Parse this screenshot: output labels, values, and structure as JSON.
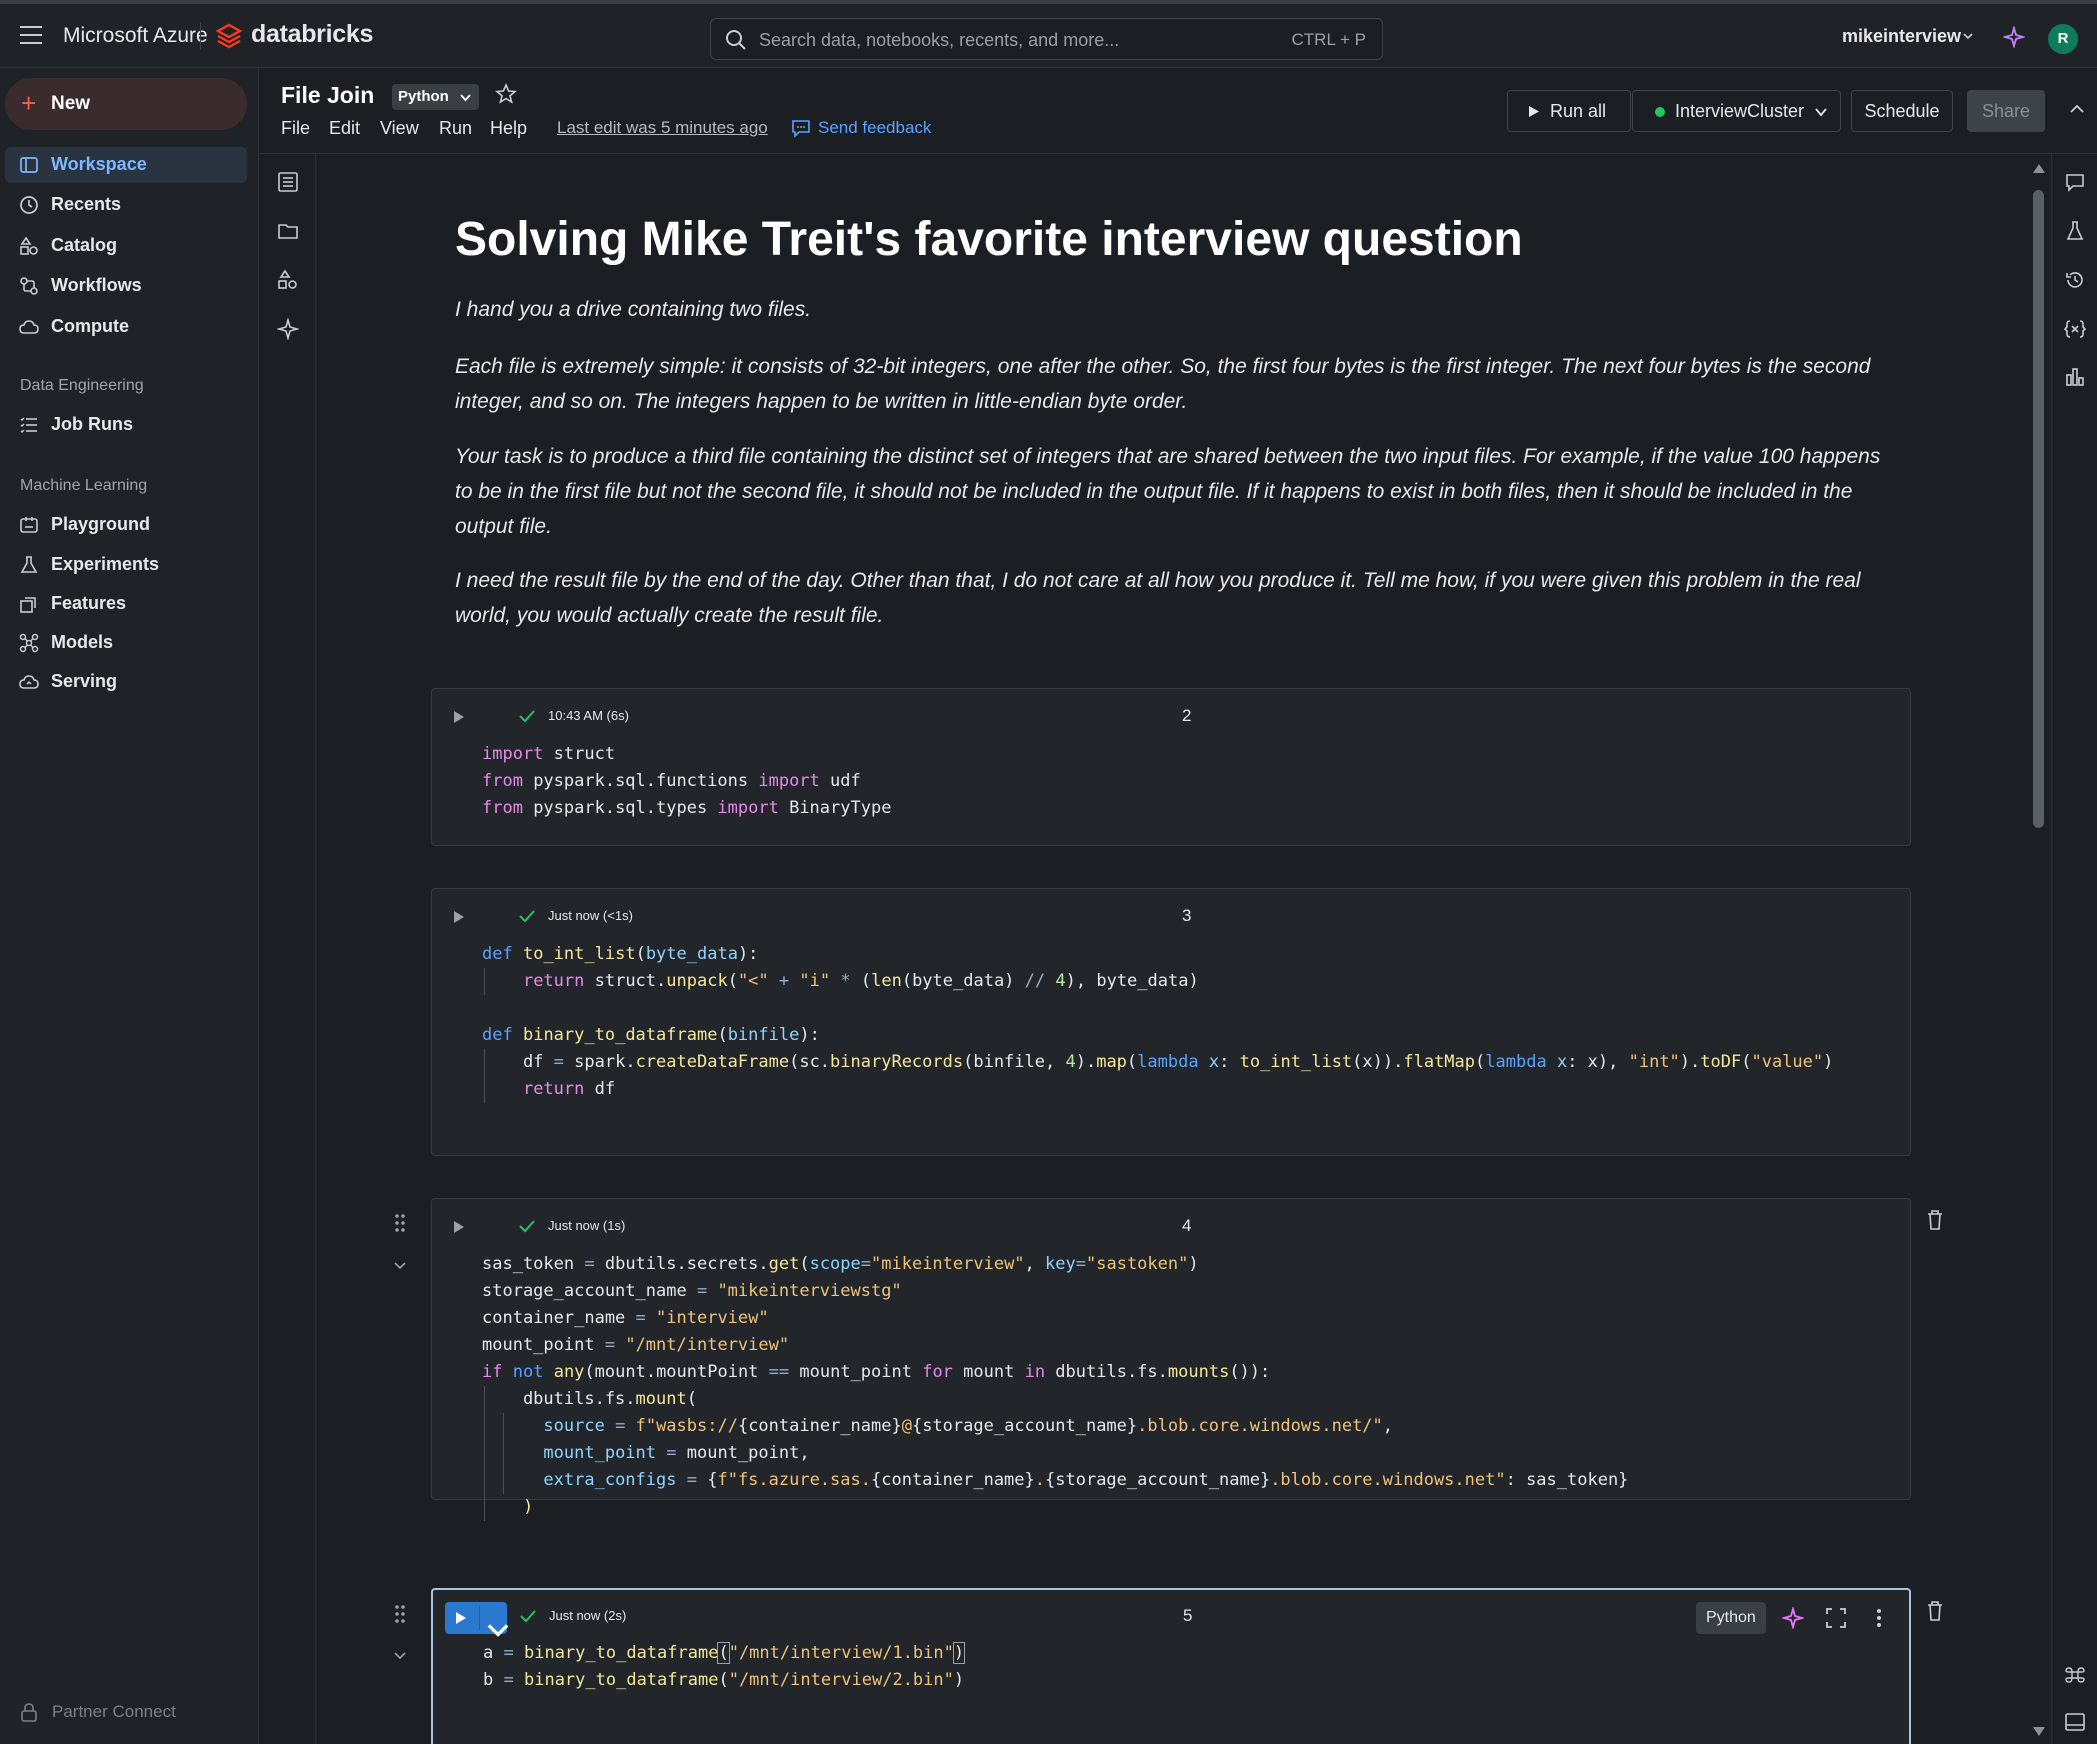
{
  "topbar": {
    "brand_ms": "Microsoft Azure",
    "brand_db": "databricks",
    "search_placeholder": "Search data, notebooks, recents, and more...",
    "search_shortcut": "CTRL + P",
    "user": "mikeinterview",
    "avatar_initial": "R"
  },
  "sidebar": {
    "new_label": "New",
    "items": [
      {
        "label": "Workspace",
        "icon": "workspace-icon"
      },
      {
        "label": "Recents",
        "icon": "clock-icon"
      },
      {
        "label": "Catalog",
        "icon": "catalog-icon"
      },
      {
        "label": "Workflows",
        "icon": "workflows-icon"
      },
      {
        "label": "Compute",
        "icon": "cloud-icon"
      }
    ],
    "section_data_engineering": "Data Engineering",
    "data_engineering_items": [
      {
        "label": "Job Runs",
        "icon": "list-icon"
      }
    ],
    "section_ml": "Machine Learning",
    "ml_items": [
      {
        "label": "Playground",
        "icon": "playground-icon"
      },
      {
        "label": "Experiments",
        "icon": "flask-icon"
      },
      {
        "label": "Features",
        "icon": "features-icon"
      },
      {
        "label": "Models",
        "icon": "models-icon"
      },
      {
        "label": "Serving",
        "icon": "serving-icon"
      }
    ],
    "partner_connect": "Partner Connect"
  },
  "notebook": {
    "title": "File Join",
    "language": "Python",
    "menu": [
      "File",
      "Edit",
      "View",
      "Run",
      "Help"
    ],
    "last_edit": "Last edit was 5 minutes ago",
    "send_feedback": "Send feedback",
    "run_all": "Run all",
    "cluster": "InterviewCluster",
    "schedule": "Schedule",
    "share": "Share"
  },
  "markdown": {
    "heading": "Solving Mike Treit's favorite interview question",
    "p1": "I hand you a drive containing two files.",
    "p2_line1": "Each file is extremely simple: it consists of 32-bit integers, one after the other. So, the first four bytes is the first integer. The next four bytes is the second",
    "p2_line2": "integer, and so on. The integers happen to be written in little-endian byte order.",
    "p3_line1": "Your task is to produce a third file containing the distinct set of integers that are shared between the two input files. For example, if the value 100 happens",
    "p3_line2": "to be in the first file but not the second file, it should not be included in the output file. If it happens to exist in both files, then it should be included in the",
    "p3_line3": "output file.",
    "p4_line1": "I need the result file by the end of the day. Other than that, I do not care at all how you produce it. Tell me how, if you were given this problem in the real",
    "p4_line2": "world, you would actually create the result file."
  },
  "cells": [
    {
      "number": "2",
      "time": "10:43 AM (6s)"
    },
    {
      "number": "3",
      "time": "Just now (<1s)"
    },
    {
      "number": "4",
      "time": "Just now (1s)"
    },
    {
      "number": "5",
      "time": "Just now (2s)",
      "language_badge": "Python"
    }
  ],
  "colors": {
    "accent_blue": "#2b78d1",
    "brand_red": "#ff3621",
    "success_green": "#22c55e"
  }
}
